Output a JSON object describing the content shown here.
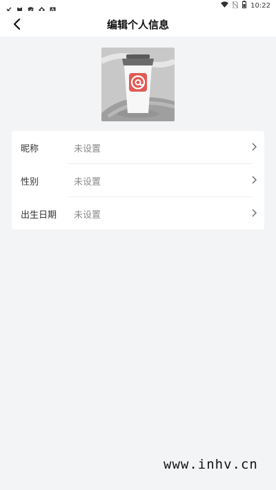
{
  "status_bar": {
    "time": "10:22",
    "left_icons": [
      "notification-icon-1",
      "clipboard-icon",
      "shield-icon",
      "gear-icon",
      "app-icon"
    ],
    "right_icons": [
      "wifi-icon",
      "no-sim-icon",
      "battery-icon"
    ]
  },
  "header": {
    "title": "编辑个人信息",
    "back_icon": "chevron-left-icon"
  },
  "profile": {
    "avatar_icon": "coffee-cup-avatar"
  },
  "fields": [
    {
      "label": "昵称",
      "value": "未设置"
    },
    {
      "label": "性别",
      "value": "未设置"
    },
    {
      "label": "出生日期",
      "value": "未设置"
    }
  ],
  "watermark": "www.inhv.cn",
  "colors": {
    "background": "#f3f4f6",
    "card": "#ffffff",
    "label": "#333333",
    "value": "#8a8a8a",
    "avatar_accent": "#e05a55"
  }
}
